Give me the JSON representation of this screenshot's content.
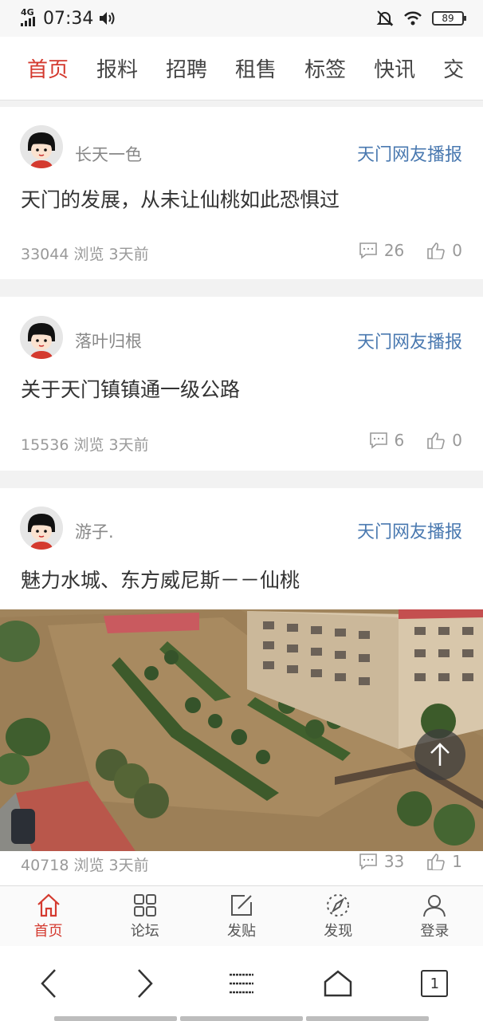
{
  "status_bar": {
    "network": "4G",
    "time": "07:34",
    "battery": "89"
  },
  "tabs": [
    {
      "label": "首页",
      "active": true
    },
    {
      "label": "报料",
      "active": false
    },
    {
      "label": "招聘",
      "active": false
    },
    {
      "label": "租售",
      "active": false
    },
    {
      "label": "标签",
      "active": false
    },
    {
      "label": "快讯",
      "active": false
    },
    {
      "label": "交",
      "active": false
    }
  ],
  "posts": [
    {
      "username": "长天一色",
      "source": "天门网友播报",
      "title": "天门的发展，从未让仙桃如此恐惧过",
      "meta": "33044 浏览   3天前",
      "comments": "26",
      "likes": "0"
    },
    {
      "username": "落叶归根",
      "source": "天门网友播报",
      "title": "关于天门镇镇通一级公路",
      "meta": "15536 浏览   3天前",
      "comments": "6",
      "likes": "0"
    },
    {
      "username": "游子.",
      "source": "天门网友播报",
      "title": "魅力水城、东方威尼斯－－仙桃",
      "meta": "40718 浏览   3天前",
      "comments": "33",
      "likes": "1"
    }
  ],
  "bottom_nav": [
    {
      "label": "首页",
      "icon": "home-icon",
      "active": true
    },
    {
      "label": "论坛",
      "icon": "grid-icon",
      "active": false
    },
    {
      "label": "发贴",
      "icon": "edit-icon",
      "active": false
    },
    {
      "label": "发现",
      "icon": "compass-icon",
      "active": false
    },
    {
      "label": "登录",
      "icon": "user-icon",
      "active": false
    }
  ],
  "system_nav": {
    "tab_count": "1"
  },
  "colors": {
    "accent": "#d43a2f",
    "link": "#4a79b0"
  }
}
